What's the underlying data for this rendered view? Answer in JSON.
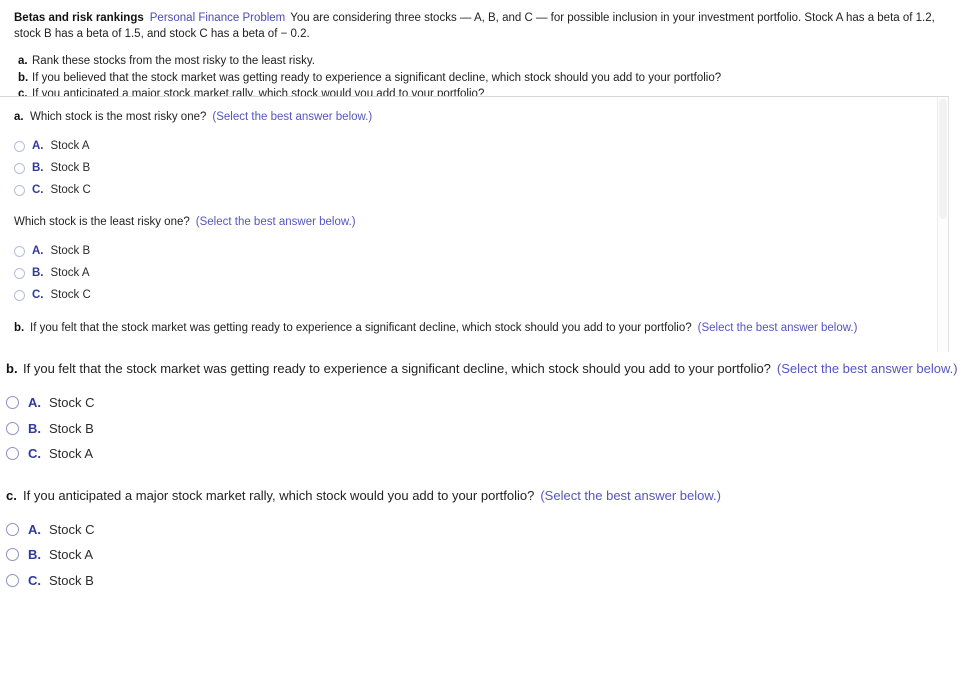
{
  "problem": {
    "title": "Betas and risk rankings",
    "tag": "Personal Finance Problem",
    "statement": "You are considering three stocks — A, B, and C — for possible inclusion in your investment portfolio.   Stock A has a beta of 1.2, stock B has a beta of 1.5, and stock C has a beta of  − 0.2.",
    "subquestions": [
      {
        "letter": "a.",
        "text": "Rank these stocks from the most risky to the least risky."
      },
      {
        "letter": "b.",
        "text": "If you believed that the stock market was getting ready to experience a significant decline, which stock should you add to your portfolio?"
      },
      {
        "letter": "c.",
        "text": "If you anticipated a major stock market rally, which stock would you add to your portfolio?"
      }
    ]
  },
  "hint_text": "(Select the best answer below.)",
  "panel": {
    "blocks": [
      {
        "letter": "a.",
        "prompt": "Which stock is the most risky one?",
        "options": [
          {
            "letter": "A.",
            "label": "Stock A"
          },
          {
            "letter": "B.",
            "label": "Stock B"
          },
          {
            "letter": "C.",
            "label": "Stock C"
          }
        ]
      },
      {
        "letter": "",
        "prompt": "Which stock is the least risky one?",
        "options": [
          {
            "letter": "A.",
            "label": "Stock B"
          },
          {
            "letter": "B.",
            "label": "Stock A"
          },
          {
            "letter": "C.",
            "label": "Stock C"
          }
        ]
      },
      {
        "letter": "b.",
        "prompt": "If you felt that the stock market was getting ready to experience a significant decline, which stock should you add to your portfolio?",
        "options": []
      }
    ]
  },
  "main": {
    "blocks": [
      {
        "letter": "b.",
        "prompt": "If you felt that the stock market was getting ready to experience a significant decline, which stock should you add to your portfolio?",
        "options": [
          {
            "letter": "A.",
            "label": "Stock C"
          },
          {
            "letter": "B.",
            "label": "Stock B"
          },
          {
            "letter": "C.",
            "label": "Stock A"
          }
        ]
      },
      {
        "letter": "c.",
        "prompt": "If you anticipated a major stock market rally, which stock would you add to your portfolio?",
        "options": [
          {
            "letter": "A.",
            "label": "Stock C"
          },
          {
            "letter": "B.",
            "label": "Stock A"
          },
          {
            "letter": "C.",
            "label": "Stock B"
          }
        ]
      }
    ]
  },
  "colors": {
    "link": "#4a4ab8",
    "hint": "#5555c0",
    "option_letter": "#2f3a9e"
  }
}
